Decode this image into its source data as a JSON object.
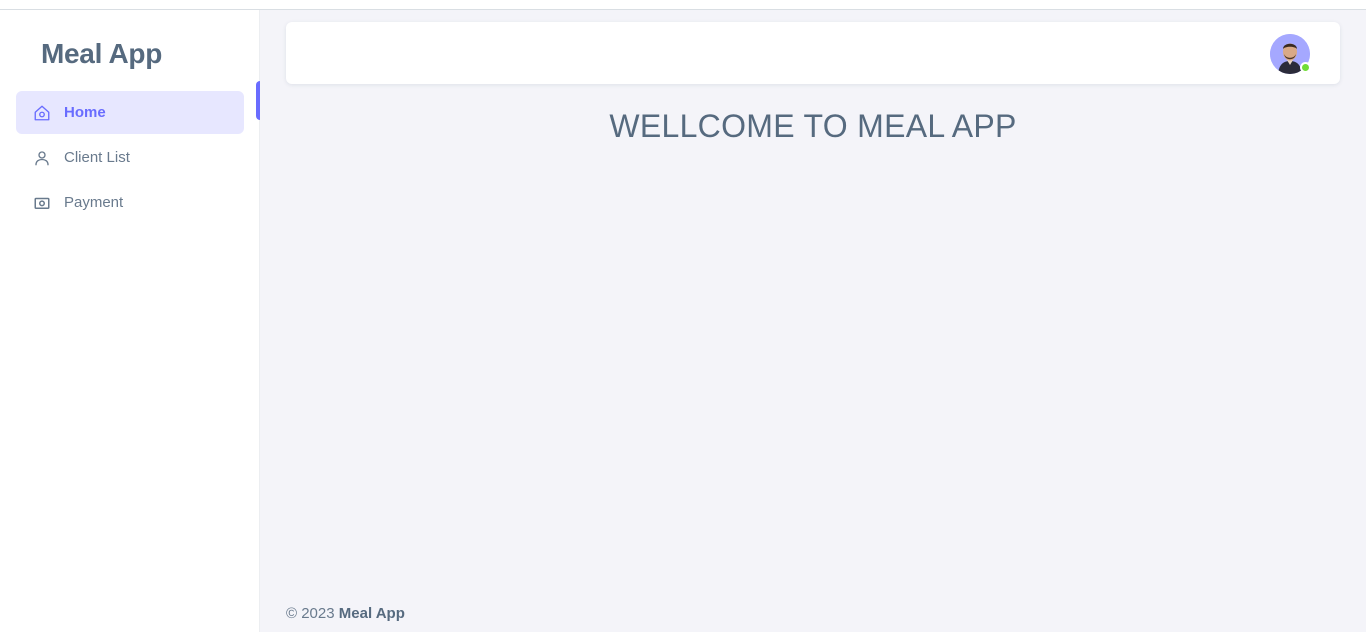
{
  "brand": {
    "name": "Meal App"
  },
  "sidebar": {
    "items": [
      {
        "label": "Home",
        "icon": "home-icon",
        "active": true
      },
      {
        "label": "Client List",
        "icon": "user-icon",
        "active": false
      },
      {
        "label": "Payment",
        "icon": "money-icon",
        "active": false
      }
    ]
  },
  "main": {
    "heading": "WELLCOME TO MEAL APP"
  },
  "navbar": {
    "avatar_icon": "user-avatar",
    "status": "online"
  },
  "footer": {
    "copyright": "© 2023",
    "brand": "Meal App"
  },
  "colors": {
    "accent": "#696cff",
    "accent_light": "#e7e7ff",
    "text": "#566a7f",
    "online": "#71dd37",
    "background": "#f4f4f9"
  }
}
